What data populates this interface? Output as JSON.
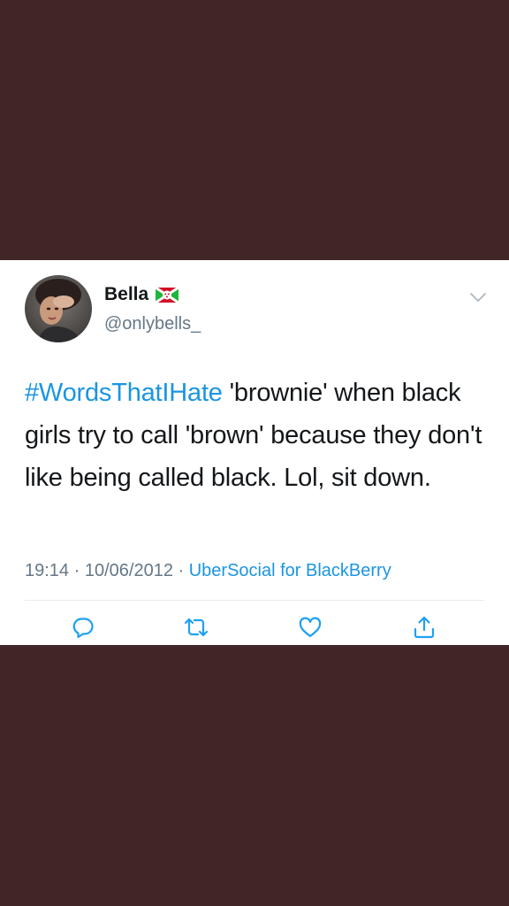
{
  "tweet": {
    "display_name": "Bella",
    "handle": "@onlybells_",
    "hashtag": "#WordsThatIHate",
    "body": " 'brownie' when black girls try to call 'brown' because they don't like being called black. Lol, sit down.",
    "time": "19:14",
    "separator1": " · ",
    "date": "10/06/2012",
    "separator2": " · ",
    "source": "UberSocial for BlackBerry"
  },
  "icons": {
    "avatar": "profile-photo",
    "flag": "burundi-flag-icon",
    "menu": "chevron-down-icon",
    "reply": "reply-icon",
    "retweet": "retweet-icon",
    "like": "heart-icon",
    "share": "share-icon"
  },
  "colors": {
    "background": "#412628",
    "card": "#ffffff",
    "link": "#1b95e0",
    "text": "#14171a",
    "muted": "#657786"
  }
}
